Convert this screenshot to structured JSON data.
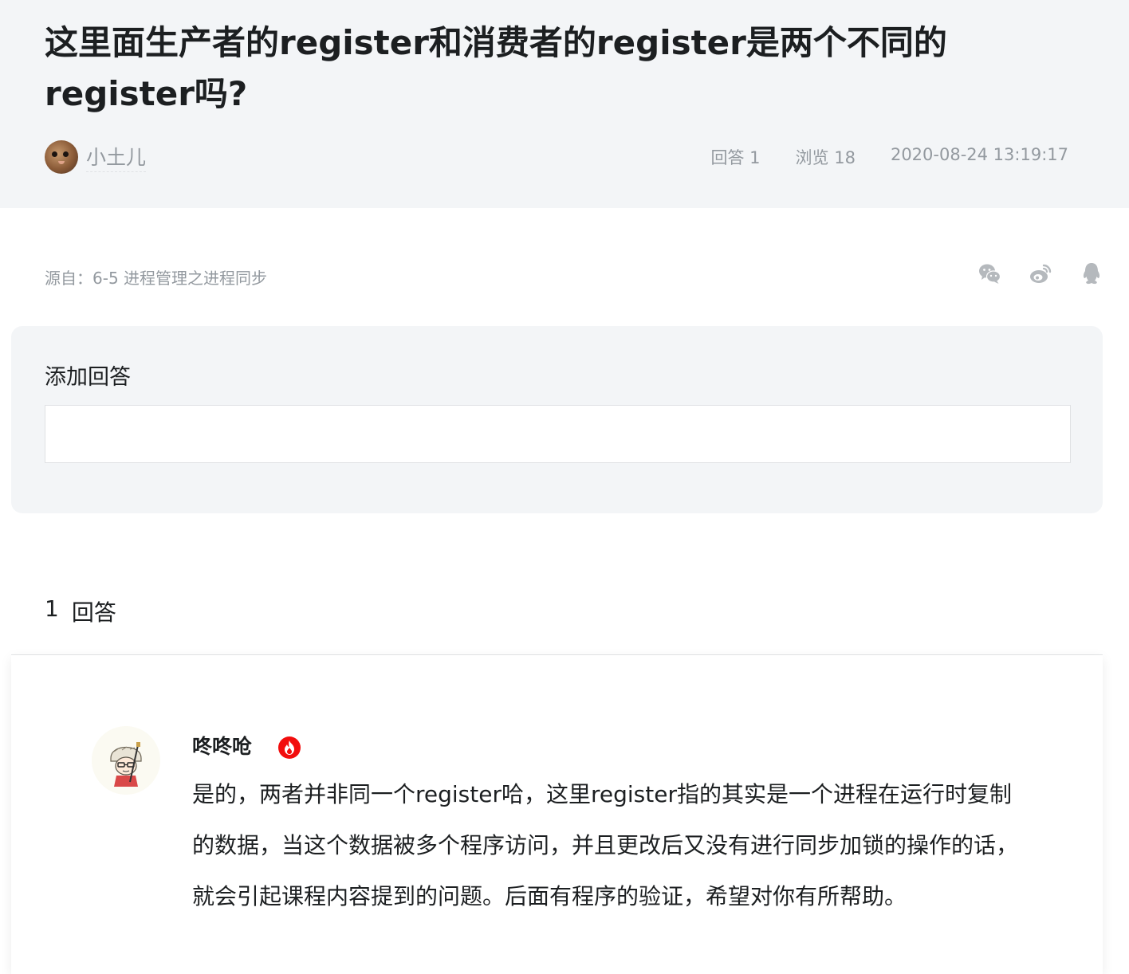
{
  "question": {
    "title": "这里面生产者的register和消费者的register是两个不同的register吗?",
    "author": "小土儿",
    "answers_label": "回答 1",
    "views_label": "浏览 18",
    "datetime": "2020-08-24 13:19:17"
  },
  "source": {
    "text": "源自：6-5 进程管理之进程同步"
  },
  "share": {
    "icons": [
      "wechat-icon",
      "weibo-icon",
      "qq-icon"
    ]
  },
  "add_answer": {
    "title": "添加回答",
    "placeholder": ""
  },
  "answers_header": {
    "count": "1",
    "label": "回答"
  },
  "answer": {
    "author": "咚咚呛",
    "badge_icon": "hot-flame-icon",
    "text": "是的，两者并非同一个register哈，这里register指的其实是一个进程在运行时复制的数据，当这个数据被多个程序访问，并且更改后又没有进行同步加锁的操作的话，就会引起课程内容提到的问题。后面有程序的验证，希望对你有所帮助。"
  },
  "colors": {
    "header_bg": "#f3f5f7",
    "muted_text": "#93999f",
    "primary_text": "#1c1f21",
    "badge_red": "#f20d0d"
  }
}
